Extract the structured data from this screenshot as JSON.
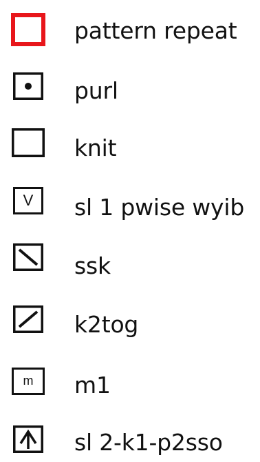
{
  "legend": {
    "items": [
      {
        "symbol": "pattern-repeat-box",
        "label": "pattern repeat",
        "color": "#e8161b"
      },
      {
        "symbol": "dot-box",
        "label": "purl",
        "color": "#111111"
      },
      {
        "symbol": "empty-box",
        "label": "knit",
        "color": "#111111"
      },
      {
        "symbol": "v-box",
        "label": "sl 1 pwise wyib",
        "glyph": "V",
        "color": "#111111"
      },
      {
        "symbol": "backslash-box",
        "label": "ssk",
        "color": "#111111"
      },
      {
        "symbol": "slash-box",
        "label": "k2tog",
        "color": "#111111"
      },
      {
        "symbol": "m-box",
        "label": "m1",
        "glyph": "m",
        "color": "#111111"
      },
      {
        "symbol": "arrow-up-box",
        "label": "sl 2-k1-p2sso",
        "color": "#111111"
      }
    ]
  }
}
